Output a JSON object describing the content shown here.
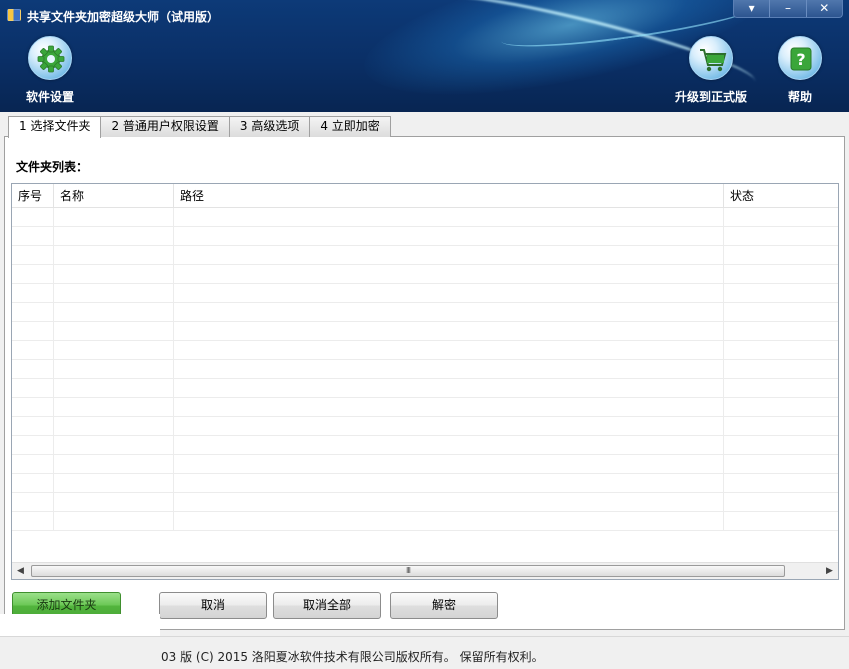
{
  "window": {
    "title": "共享文件夹加密超级大师（试用版）",
    "controls": [
      "▾",
      "–",
      "✕"
    ]
  },
  "toolbar": {
    "settings_label": "软件设置",
    "settings_icon": "gear-icon",
    "upgrade_label": "升级到正式版",
    "upgrade_icon": "cart-icon",
    "help_label": "帮助",
    "help_icon": "question-icon"
  },
  "tabs": [
    {
      "label": "1 选择文件夹",
      "active": true
    },
    {
      "label": "2 普通用户权限设置",
      "active": false
    },
    {
      "label": "3 高级选项",
      "active": false
    },
    {
      "label": "4 立即加密",
      "active": false
    }
  ],
  "folder_list": {
    "label": "文件夹列表：",
    "columns": [
      "序号",
      "名称",
      "路径",
      "状态"
    ],
    "rows": []
  },
  "scrollbar": {
    "left_arrow": "◀",
    "right_arrow": "▶",
    "thumb_grip": "III"
  },
  "buttons": {
    "add_folder": "添加文件夹",
    "cancel": "取消",
    "cancel_all": "取消全部",
    "decrypt": "解密"
  },
  "status": {
    "text": "03 版 (C) 2015 洛阳夏冰软件技术有限公司版权所有。 保留所有权利。"
  },
  "colors": {
    "header_bg": "#0a2f66",
    "add_button": "#6cc857"
  }
}
